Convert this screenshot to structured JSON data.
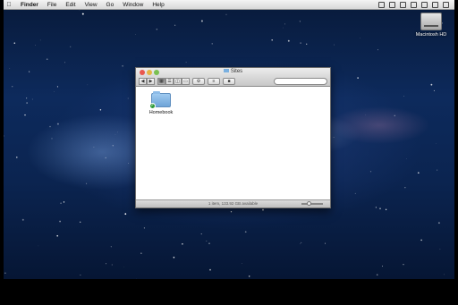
{
  "menubar": {
    "apple_icon": "apple-icon",
    "items": [
      "Finder",
      "File",
      "Edit",
      "View",
      "Go",
      "Window",
      "Help"
    ]
  },
  "desktop": {
    "hard_drive_label": "Macintosh HD"
  },
  "finder": {
    "title": "Sites",
    "search_placeholder": "",
    "folder_name": "Homebook",
    "status_text": "1 item, 133.92 GB available"
  }
}
